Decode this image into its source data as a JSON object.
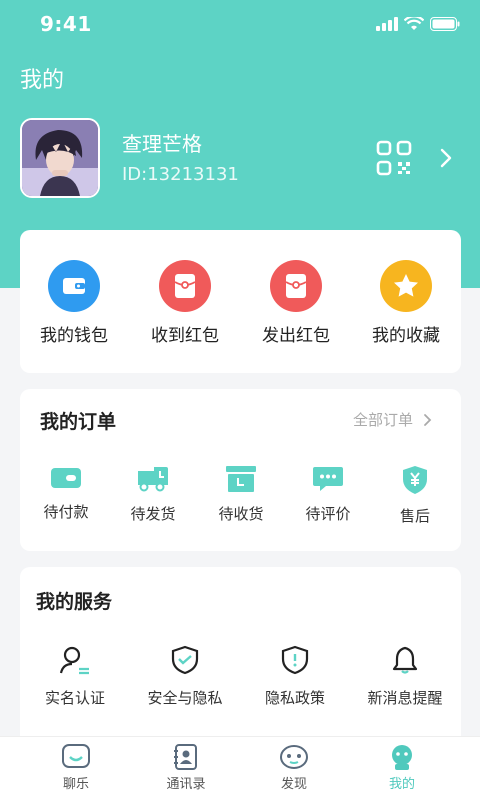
{
  "status": {
    "time": "9:41"
  },
  "header": {
    "title": "我的"
  },
  "profile": {
    "name": "查理芒格",
    "id": "ID:13213131"
  },
  "wallet": [
    {
      "label": "我的钱包",
      "icon": "wallet-icon",
      "color": "#2f9bf0"
    },
    {
      "label": "收到红包",
      "icon": "red-packet-icon",
      "color": "#f05a5a"
    },
    {
      "label": "发出红包",
      "icon": "red-packet-icon",
      "color": "#f05a5a"
    },
    {
      "label": "我的收藏",
      "icon": "star-icon",
      "color": "#f7b51f"
    }
  ],
  "orders": {
    "title": "我的订单",
    "all": "全部订单",
    "items": [
      {
        "label": "待付款",
        "icon": "wallet-card-icon"
      },
      {
        "label": "待发货",
        "icon": "truck-icon"
      },
      {
        "label": "待收货",
        "icon": "box-icon"
      },
      {
        "label": "待评价",
        "icon": "comment-icon"
      },
      {
        "label": "售后",
        "icon": "shield-yen-icon"
      }
    ]
  },
  "services": {
    "title": "我的服务",
    "items": [
      {
        "label": "实名认证",
        "icon": "user-verify-icon"
      },
      {
        "label": "安全与隐私",
        "icon": "shield-check-icon"
      },
      {
        "label": "隐私政策",
        "icon": "shield-alert-icon"
      },
      {
        "label": "新消息提醒",
        "icon": "bell-icon"
      }
    ]
  },
  "tabs": [
    {
      "label": "聊乐",
      "icon": "chat-icon"
    },
    {
      "label": "通讯录",
      "icon": "contacts-icon"
    },
    {
      "label": "发现",
      "icon": "discover-icon"
    },
    {
      "label": "我的",
      "icon": "profile-icon",
      "active": true
    }
  ],
  "colors": {
    "primary": "#5dd3c5",
    "active_tab": "#4fc9bd"
  }
}
